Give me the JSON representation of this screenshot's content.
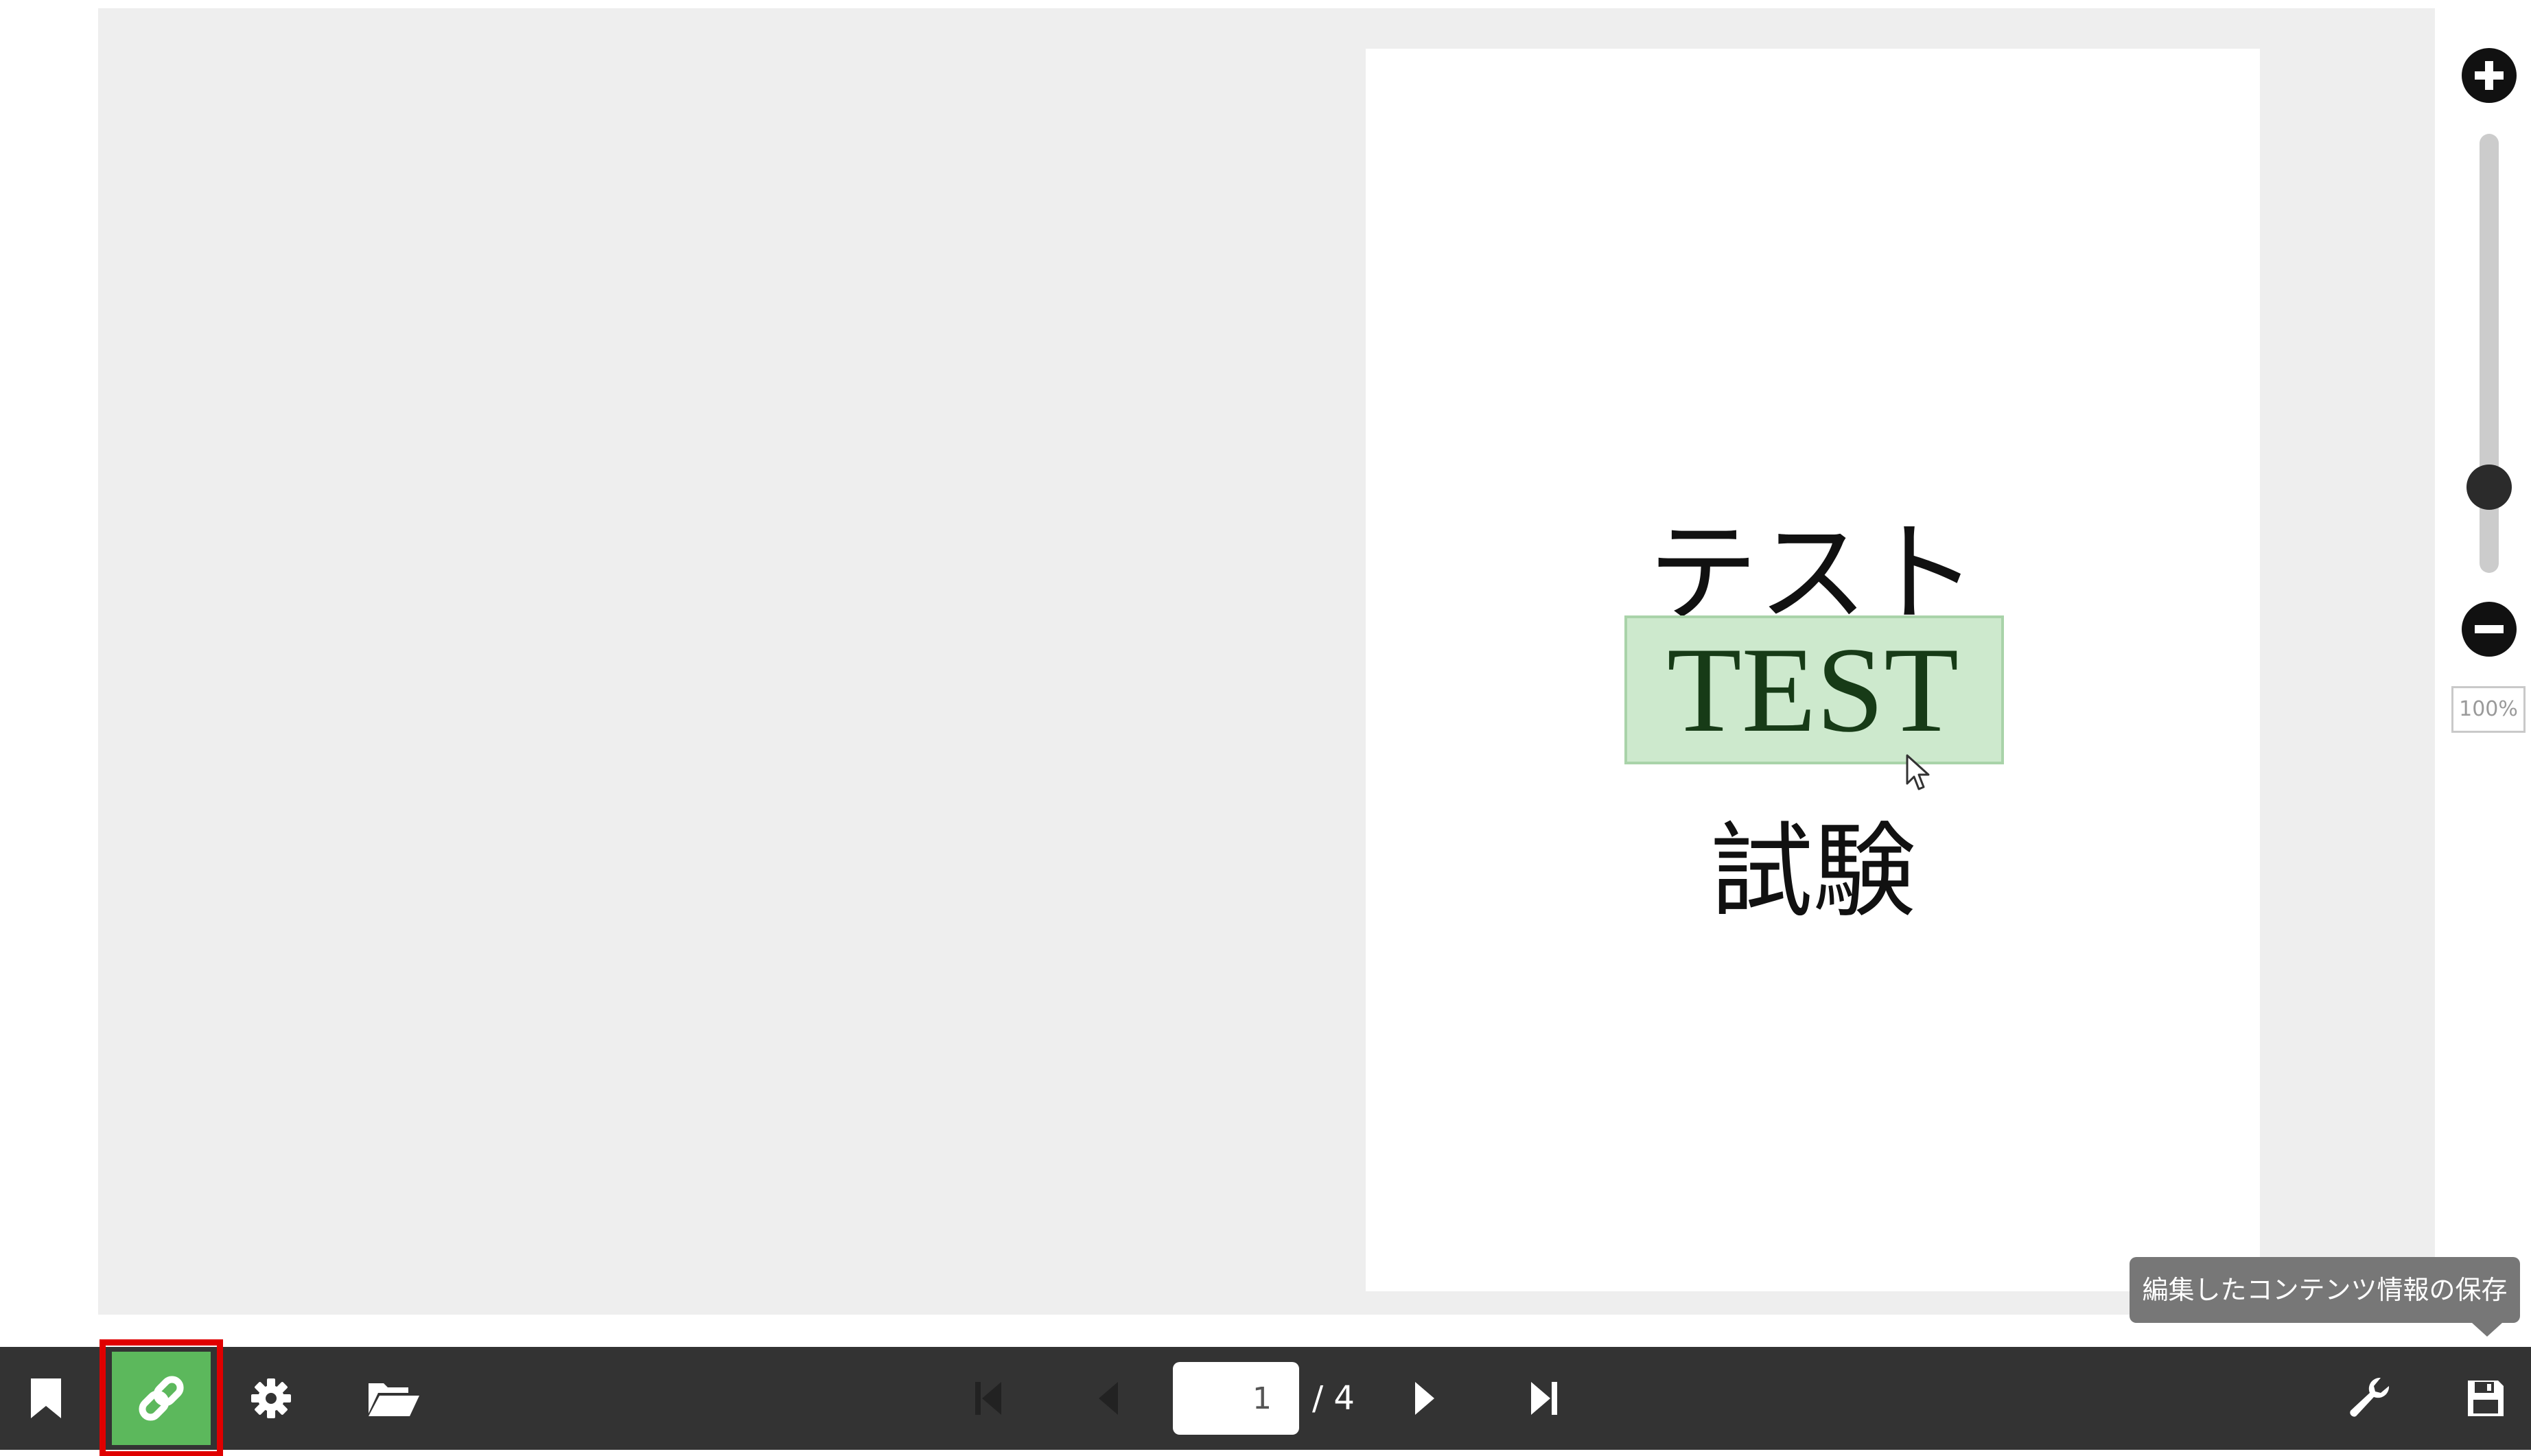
{
  "document": {
    "line1": "テスト",
    "line2": "TEST",
    "line3": "試験"
  },
  "zoom": {
    "level_label": "100%",
    "slider_level_fraction": 0.17
  },
  "tooltip": {
    "text": "編集したコンテンツ情報の保存"
  },
  "navigation": {
    "current_page": "1",
    "total_label": "/ 4"
  },
  "colors": {
    "toolbar_bg": "#333333",
    "link_button_active": "#5cb85c",
    "highlight_border": "#e00000",
    "link_area": "#cde9cd",
    "viewer_bg": "#eeeeee"
  },
  "icons": {
    "bookmark": "bookmark-icon",
    "link": "link-icon",
    "settings": "gear-icon",
    "open": "folder-open-icon",
    "first": "first-page-icon",
    "prev": "previous-page-icon",
    "next": "next-page-icon",
    "last": "last-page-icon",
    "tools": "wrench-icon",
    "save": "save-icon",
    "zoom_in": "plus-icon",
    "zoom_out": "minus-icon"
  }
}
